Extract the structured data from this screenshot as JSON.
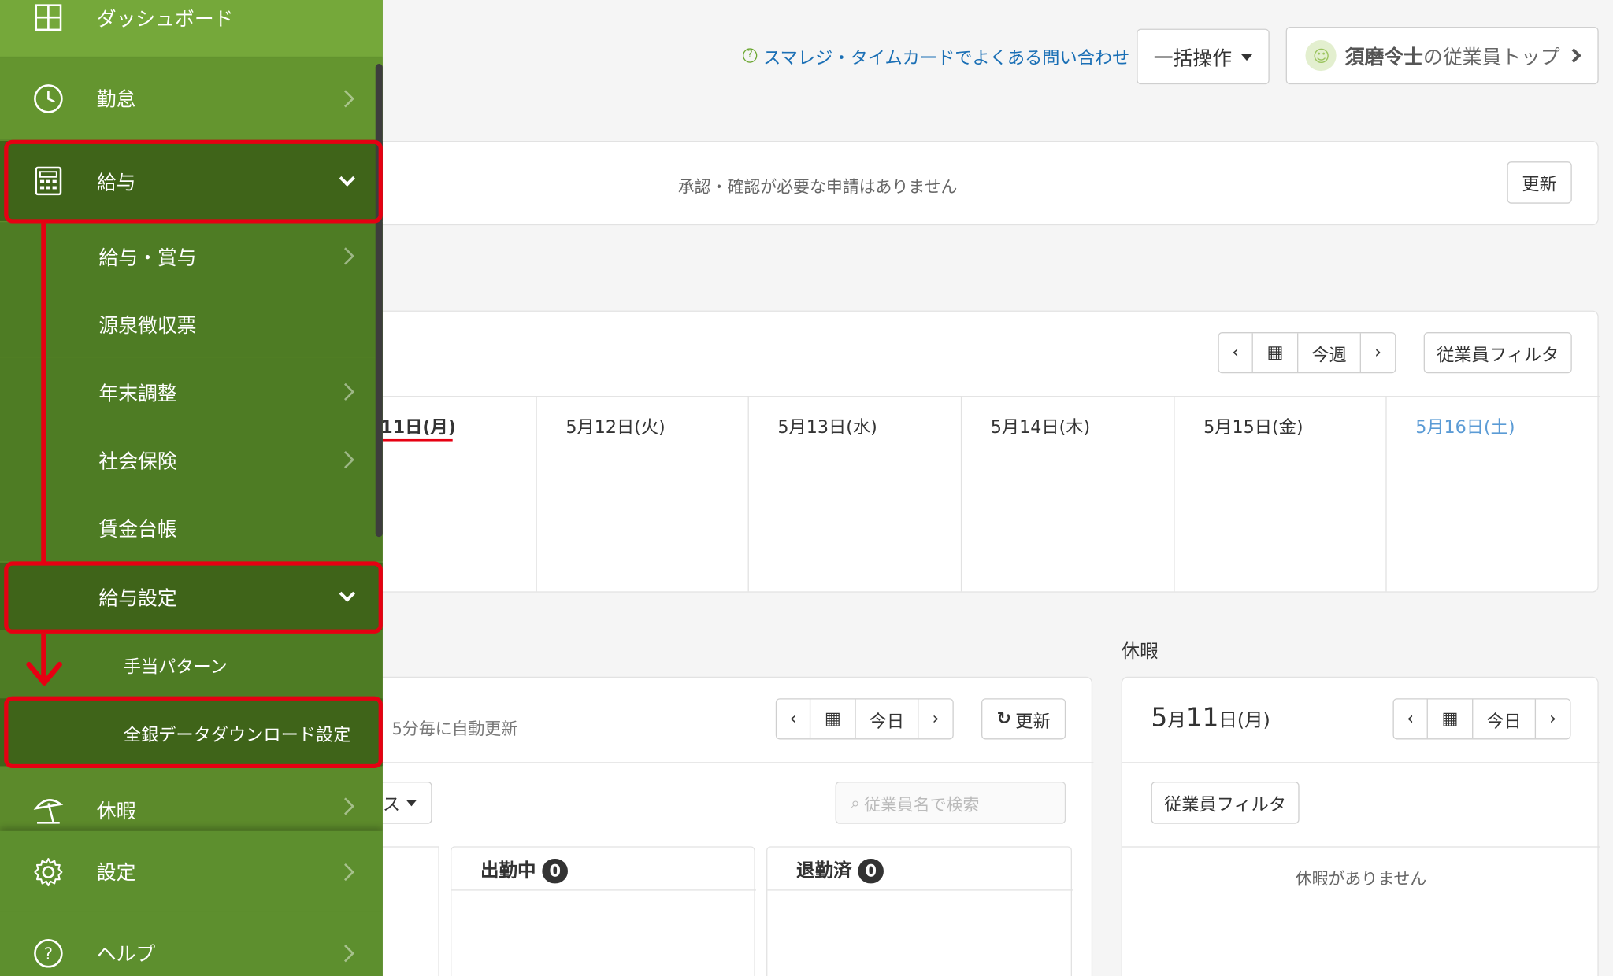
{
  "sidebar": {
    "dashboard": "ダッシュボード",
    "attendance": "勤怠",
    "payroll": "給与",
    "payroll_children": {
      "salary_bonus": "給与・賞与",
      "withholding": "源泉徴収票",
      "year_end": "年末調整",
      "social_insurance": "社会保険",
      "wage_ledger": "賃金台帳",
      "payroll_settings": "給与設定",
      "allowance_pattern": "手当パターン",
      "zengin_download": "全銀データダウンロード設定"
    },
    "leave": "休暇",
    "settings": "設定",
    "help": "ヘルプ"
  },
  "header": {
    "faq_link": "スマレジ・タイムカードでよくある問い合わせ",
    "bulk_label": "一括操作",
    "user_name": "須磨令士",
    "user_suffix": "の従業員トップ"
  },
  "approval": {
    "message": "承認・確認が必要な申請はありません",
    "refresh": "更新"
  },
  "schedule": {
    "nav_prev": "‹",
    "nav_today": "今週",
    "nav_next": "›",
    "filter": "従業員フィルタ",
    "days": [
      "11日(月)",
      "5月12日(火)",
      "5月13日(水)",
      "5月14日(木)",
      "5月15日(金)",
      "5月16日(土)"
    ]
  },
  "attendance_panel": {
    "auto_refresh": "5分毎に自動更新",
    "today": "今日",
    "refresh": "更新",
    "status_dropdown": "ス",
    "search_placeholder": "従業員名で検索",
    "working_label": "出勤中",
    "working_count": "0",
    "left_label": "退勤済",
    "left_count": "0"
  },
  "leave_panel": {
    "title": "休暇",
    "date_month": "5",
    "date_month_unit": "月",
    "date_day": "11",
    "date_day_unit": "日(月)",
    "today": "今日",
    "filter": "従業員フィルタ",
    "empty": "休暇がありません"
  },
  "colors": {
    "sidebar": "#5c8a2b",
    "sidebar_active": "#3f6419",
    "highlight": "#e60012",
    "link": "#1a6fb5",
    "saturday": "#5b9bd5"
  }
}
